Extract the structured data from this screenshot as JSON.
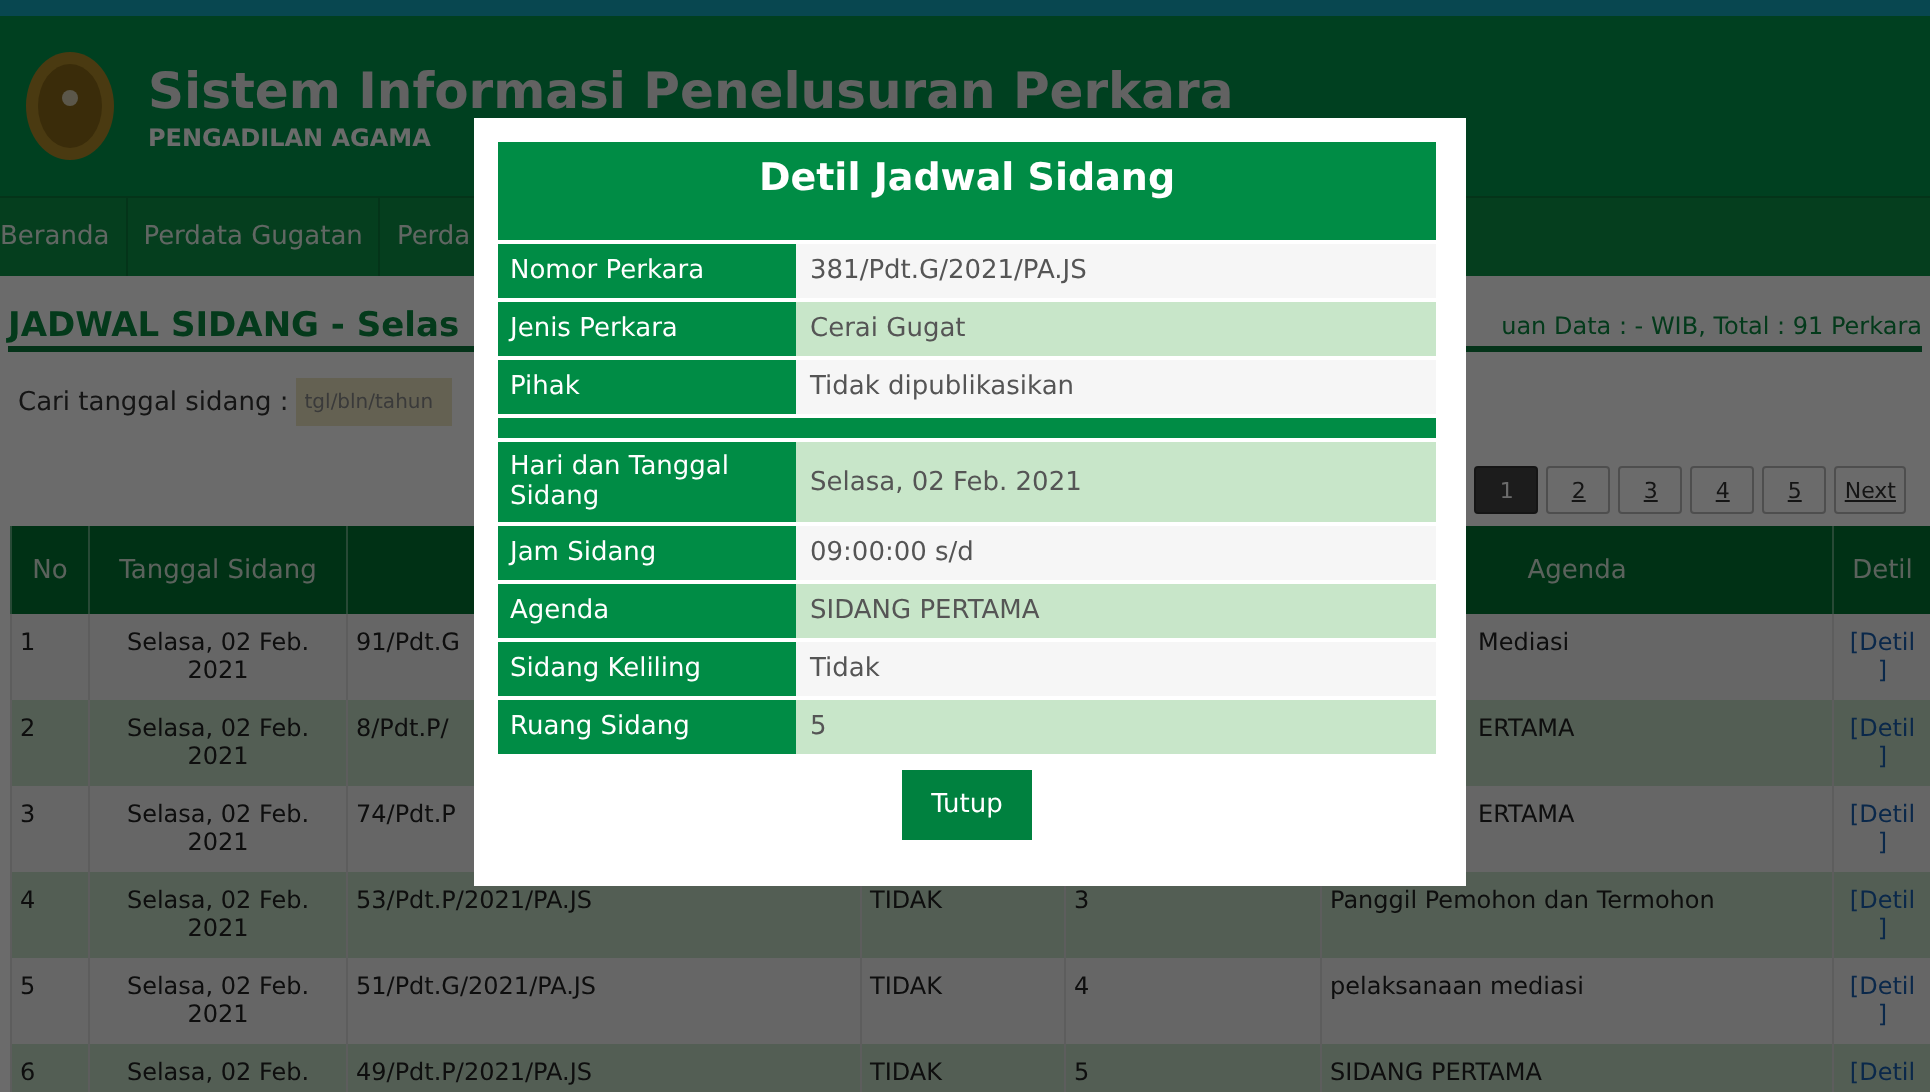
{
  "header": {
    "title": "Sistem Informasi Penelusuran Perkara",
    "subtitle": "PENGADILAN AGAMA"
  },
  "nav": [
    {
      "label": "Beranda"
    },
    {
      "label": "Perdata Gugatan"
    },
    {
      "label": "Perda"
    }
  ],
  "page_title": "JADWAL SIDANG - Selas",
  "update_info": "uan Data : - WIB, Total : 91 Perkara",
  "search": {
    "label": "Cari tanggal sidang :",
    "placeholder": "tgl/bln/tahun"
  },
  "pagination": [
    {
      "label": "1",
      "selected": true
    },
    {
      "label": "2",
      "selected": false
    },
    {
      "label": "3",
      "selected": false
    },
    {
      "label": "4",
      "selected": false
    },
    {
      "label": "5",
      "selected": false
    },
    {
      "label": "Next",
      "selected": false
    }
  ],
  "table": {
    "columns": [
      "No",
      "Tanggal Sidang",
      "",
      "",
      "",
      "Agenda",
      "Detil"
    ],
    "rows": [
      {
        "no": "1",
        "tanggal": "Selasa, 02 Feb. 2021",
        "nomor": "91/Pdt.G",
        "keliling": "",
        "ruang": "",
        "agenda": "Mediasi",
        "covered": true,
        "detil": "[Detil ]"
      },
      {
        "no": "2",
        "tanggal": "Selasa, 02 Feb. 2021",
        "nomor": "8/Pdt.P/",
        "keliling": "",
        "ruang": "",
        "agenda": "ERTAMA",
        "covered": true,
        "detil": "[Detil ]"
      },
      {
        "no": "3",
        "tanggal": "Selasa, 02 Feb. 2021",
        "nomor": "74/Pdt.P",
        "keliling": "",
        "ruang": "",
        "agenda": "ERTAMA",
        "covered": true,
        "detil": "[Detil ]"
      },
      {
        "no": "4",
        "tanggal": "Selasa, 02 Feb. 2021",
        "nomor": "53/Pdt.P/2021/PA.JS",
        "keliling": "TIDAK",
        "ruang": "3",
        "agenda": "Panggil Pemohon dan Termohon",
        "covered": false,
        "detil": "[Detil ]"
      },
      {
        "no": "5",
        "tanggal": "Selasa, 02 Feb. 2021",
        "nomor": "51/Pdt.G/2021/PA.JS",
        "keliling": "TIDAK",
        "ruang": "4",
        "agenda": "pelaksanaan mediasi",
        "covered": false,
        "detil": "[Detil ]"
      },
      {
        "no": "6",
        "tanggal": "Selasa, 02 Feb.",
        "nomor": "49/Pdt.P/2021/PA.JS",
        "keliling": "TIDAK",
        "ruang": "5",
        "agenda": "SIDANG PERTAMA",
        "covered": false,
        "detil": "[Detil"
      }
    ]
  },
  "modal": {
    "title": "Detil Jadwal Sidang",
    "rows": [
      {
        "kind": "field",
        "label": "Nomor Perkara",
        "value": "381/Pdt.G/2021/PA.JS"
      },
      {
        "kind": "field",
        "label": "Jenis Perkara",
        "value": "Cerai Gugat"
      },
      {
        "kind": "field",
        "label": "Pihak",
        "value": "Tidak dipublikasikan"
      },
      {
        "kind": "separator"
      },
      {
        "kind": "field",
        "label": "Hari dan Tanggal Sidang",
        "value": "Selasa, 02 Feb. 2021"
      },
      {
        "kind": "field",
        "label": "Jam Sidang",
        "value": "09:00:00 s/d"
      },
      {
        "kind": "field",
        "label": "Agenda",
        "value": "SIDANG PERTAMA"
      },
      {
        "kind": "field",
        "label": "Sidang Keliling",
        "value": "Tidak"
      },
      {
        "kind": "field",
        "label": "Ruang Sidang",
        "value": "5"
      }
    ],
    "button": "Tutup"
  }
}
